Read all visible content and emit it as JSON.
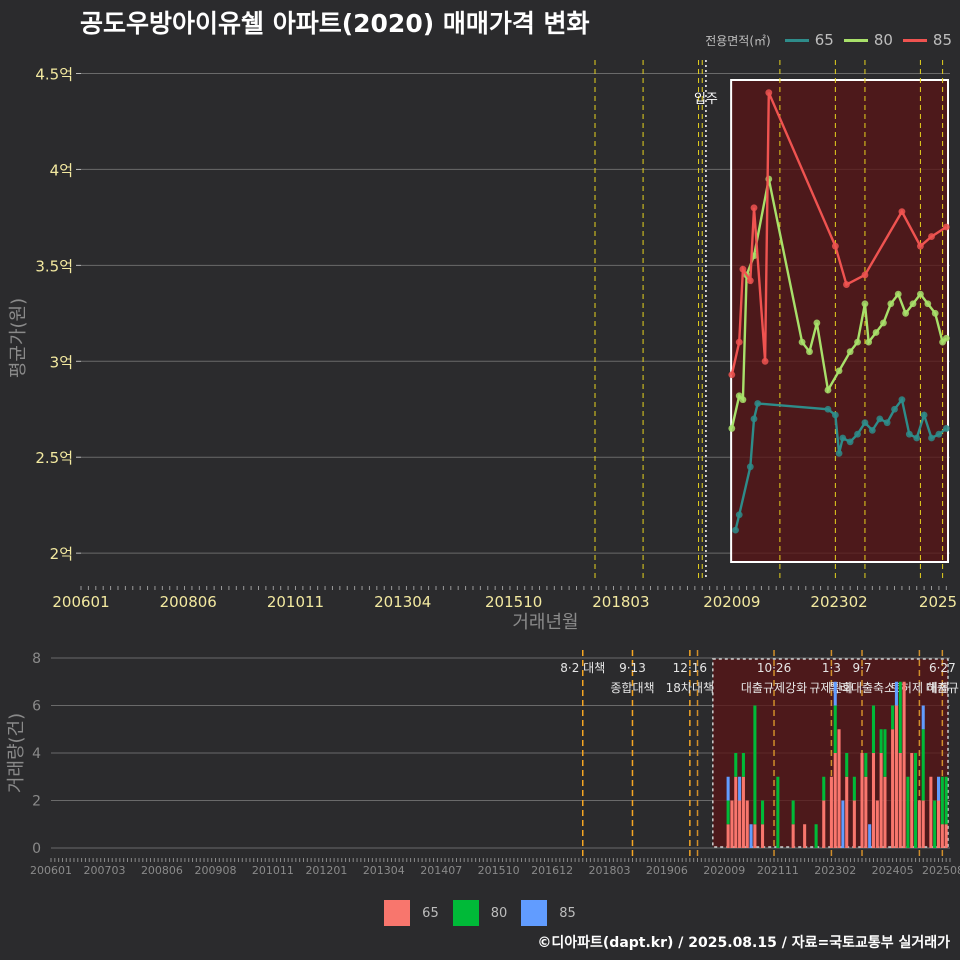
{
  "title": "공도우방아이유쉘 아파트(2020) 매매가격 변화",
  "legend": {
    "title": "전용면적(㎡)",
    "items": [
      {
        "label": "65",
        "color": "#2e8c8a"
      },
      {
        "label": "80",
        "color": "#a8e06a"
      },
      {
        "label": "85",
        "color": "#ef5350"
      }
    ]
  },
  "bar_legend": [
    {
      "label": "65",
      "color": "#f8766d"
    },
    {
      "label": "80",
      "color": "#00ba38"
    },
    {
      "label": "85",
      "color": "#619cff"
    }
  ],
  "footer": "©디아파트(dapt.kr) / 2025.08.15 / 자료=국토교통부 실거래가",
  "chart_data": [
    {
      "type": "line",
      "xlabel": "거래년월",
      "ylabel": "평균가(원)",
      "x_ticks": [
        "200601",
        "200806",
        "201011",
        "201304",
        "201510",
        "201803",
        "202009",
        "202302",
        "2025"
      ],
      "y_ticks": [
        "2억",
        "2.5억",
        "3억",
        "3.5억",
        "4억",
        "4.5억"
      ],
      "y_tick_values": [
        2.0,
        2.5,
        3.0,
        3.5,
        4.0,
        4.5
      ],
      "ylim": [
        1.86,
        4.56
      ],
      "xlim": [
        "2006-01",
        "2025-08"
      ],
      "annotation": "입주",
      "series": [
        {
          "name": "65",
          "color": "#2e8c8a",
          "points": [
            [
              "2020-10",
              2.12
            ],
            [
              "2020-11",
              2.2
            ],
            [
              "2021-02",
              2.45
            ],
            [
              "2021-03",
              2.7
            ],
            [
              "2021-04",
              2.78
            ],
            [
              "2022-11",
              2.75
            ],
            [
              "2023-01",
              2.72
            ],
            [
              "2023-02",
              2.52
            ],
            [
              "2023-03",
              2.6
            ],
            [
              "2023-05",
              2.58
            ],
            [
              "2023-07",
              2.62
            ],
            [
              "2023-09",
              2.68
            ],
            [
              "2023-11",
              2.64
            ],
            [
              "2024-01",
              2.7
            ],
            [
              "2024-03",
              2.68
            ],
            [
              "2024-05",
              2.75
            ],
            [
              "2024-07",
              2.8
            ],
            [
              "2024-09",
              2.62
            ],
            [
              "2024-11",
              2.6
            ],
            [
              "2025-01",
              2.72
            ],
            [
              "2025-03",
              2.6
            ],
            [
              "2025-05",
              2.62
            ],
            [
              "2025-07",
              2.65
            ]
          ]
        },
        {
          "name": "80",
          "color": "#a8e06a",
          "points": [
            [
              "2020-09",
              2.65
            ],
            [
              "2020-11",
              2.82
            ],
            [
              "2020-12",
              2.8
            ],
            [
              "2021-01",
              3.45
            ],
            [
              "2021-03",
              3.55
            ],
            [
              "2021-07",
              3.95
            ],
            [
              "2022-04",
              3.1
            ],
            [
              "2022-06",
              3.05
            ],
            [
              "2022-08",
              3.2
            ],
            [
              "2022-11",
              2.85
            ],
            [
              "2023-02",
              2.95
            ],
            [
              "2023-05",
              3.05
            ],
            [
              "2023-07",
              3.1
            ],
            [
              "2023-09",
              3.3
            ],
            [
              "2023-10",
              3.1
            ],
            [
              "2023-12",
              3.15
            ],
            [
              "2024-02",
              3.2
            ],
            [
              "2024-04",
              3.3
            ],
            [
              "2024-06",
              3.35
            ],
            [
              "2024-08",
              3.25
            ],
            [
              "2024-10",
              3.3
            ],
            [
              "2024-12",
              3.35
            ],
            [
              "2025-02",
              3.3
            ],
            [
              "2025-04",
              3.25
            ],
            [
              "2025-06",
              3.1
            ],
            [
              "2025-07",
              3.12
            ]
          ]
        },
        {
          "name": "85",
          "color": "#ef5350",
          "points": [
            [
              "2020-09",
              2.93
            ],
            [
              "2020-11",
              3.1
            ],
            [
              "2020-12",
              3.48
            ],
            [
              "2021-02",
              3.42
            ],
            [
              "2021-03",
              3.8
            ],
            [
              "2021-06",
              3.0
            ],
            [
              "2021-07",
              4.4
            ],
            [
              "2023-01",
              3.6
            ],
            [
              "2023-04",
              3.4
            ],
            [
              "2023-09",
              3.45
            ],
            [
              "2024-07",
              3.78
            ],
            [
              "2024-12",
              3.6
            ],
            [
              "2025-03",
              3.65
            ],
            [
              "2025-07",
              3.7
            ]
          ]
        }
      ]
    },
    {
      "type": "bar",
      "stacked": true,
      "ylabel": "거래량(건)",
      "ylim": [
        0,
        8
      ],
      "y_ticks": [
        "0",
        "2",
        "4",
        "6",
        "8"
      ],
      "x_ticks": [
        "200601",
        "200703",
        "200806",
        "200908",
        "201011",
        "201201",
        "201304",
        "201407",
        "201510",
        "201612",
        "201803",
        "201906",
        "202009",
        "202111",
        "202302",
        "202405",
        "202508"
      ],
      "policy_labels": [
        {
          "date": "2017-08",
          "text": "8·2 대책",
          "line2": ""
        },
        {
          "date": "2018-09",
          "text": "9·13",
          "line2": "종합대책"
        },
        {
          "date": "2019-12",
          "text": "12·16",
          "line2": "18차대책"
        },
        {
          "date": "2021-10",
          "text": "10·26",
          "line2": "대출규제강화"
        },
        {
          "date": "2023-01",
          "text": "1·3",
          "line2": "규제완화"
        },
        {
          "date": "2023-09",
          "text": "9·7",
          "line2": "특례대출축소"
        },
        {
          "date": "2024-12",
          "text": "",
          "line2": "토허제 해제"
        },
        {
          "date": "2025-06",
          "text": "6·27",
          "line2": "대출규"
        }
      ],
      "series": [
        {
          "name": "65",
          "color": "#f8766d",
          "values_by_month": [
            [
              "2020-10",
              1
            ],
            [
              "2020-11",
              2
            ],
            [
              "2020-12",
              3
            ],
            [
              "2021-01",
              2
            ],
            [
              "2021-02",
              3
            ],
            [
              "2021-03",
              2
            ],
            [
              "2021-05",
              1
            ],
            [
              "2021-07",
              1
            ],
            [
              "2022-03",
              1
            ],
            [
              "2022-06",
              1
            ],
            [
              "2022-11",
              2
            ],
            [
              "2023-01",
              3
            ],
            [
              "2023-02",
              4
            ],
            [
              "2023-03",
              5
            ],
            [
              "2023-05",
              3
            ],
            [
              "2023-07",
              2
            ],
            [
              "2023-09",
              4
            ],
            [
              "2023-10",
              3
            ],
            [
              "2023-12",
              4
            ],
            [
              "2024-01",
              2
            ],
            [
              "2024-02",
              4
            ],
            [
              "2024-03",
              3
            ],
            [
              "2024-05",
              5
            ],
            [
              "2024-06",
              6
            ],
            [
              "2024-07",
              4
            ],
            [
              "2024-08",
              7
            ],
            [
              "2024-10",
              4
            ],
            [
              "2024-12",
              2
            ],
            [
              "2025-01",
              2
            ],
            [
              "2025-03",
              3
            ],
            [
              "2025-05",
              2
            ],
            [
              "2025-06",
              1
            ],
            [
              "2025-07",
              1
            ]
          ]
        },
        {
          "name": "80",
          "color": "#00ba38",
          "values_by_month": [
            [
              "2020-10",
              1
            ],
            [
              "2020-12",
              1
            ],
            [
              "2021-02",
              1
            ],
            [
              "2021-05",
              5
            ],
            [
              "2021-07",
              1
            ],
            [
              "2021-11",
              3
            ],
            [
              "2022-03",
              1
            ],
            [
              "2022-09",
              1
            ],
            [
              "2022-11",
              1
            ],
            [
              "2023-02",
              2
            ],
            [
              "2023-05",
              1
            ],
            [
              "2023-07",
              1
            ],
            [
              "2023-10",
              1
            ],
            [
              "2023-12",
              2
            ],
            [
              "2024-02",
              1
            ],
            [
              "2024-03",
              2
            ],
            [
              "2024-05",
              1
            ],
            [
              "2024-07",
              3
            ],
            [
              "2024-09",
              3
            ],
            [
              "2024-11",
              4
            ],
            [
              "2025-01",
              3
            ],
            [
              "2025-04",
              2
            ],
            [
              "2025-06",
              2
            ],
            [
              "2025-07",
              2
            ]
          ]
        },
        {
          "name": "85",
          "color": "#619cff",
          "values_by_month": [
            [
              "2020-10",
              1
            ],
            [
              "2021-01",
              1
            ],
            [
              "2021-04",
              1
            ],
            [
              "2023-02",
              1
            ],
            [
              "2023-04",
              2
            ],
            [
              "2023-11",
              1
            ],
            [
              "2024-06",
              1
            ],
            [
              "2025-01",
              1
            ],
            [
              "2025-05",
              1
            ]
          ]
        }
      ]
    }
  ]
}
